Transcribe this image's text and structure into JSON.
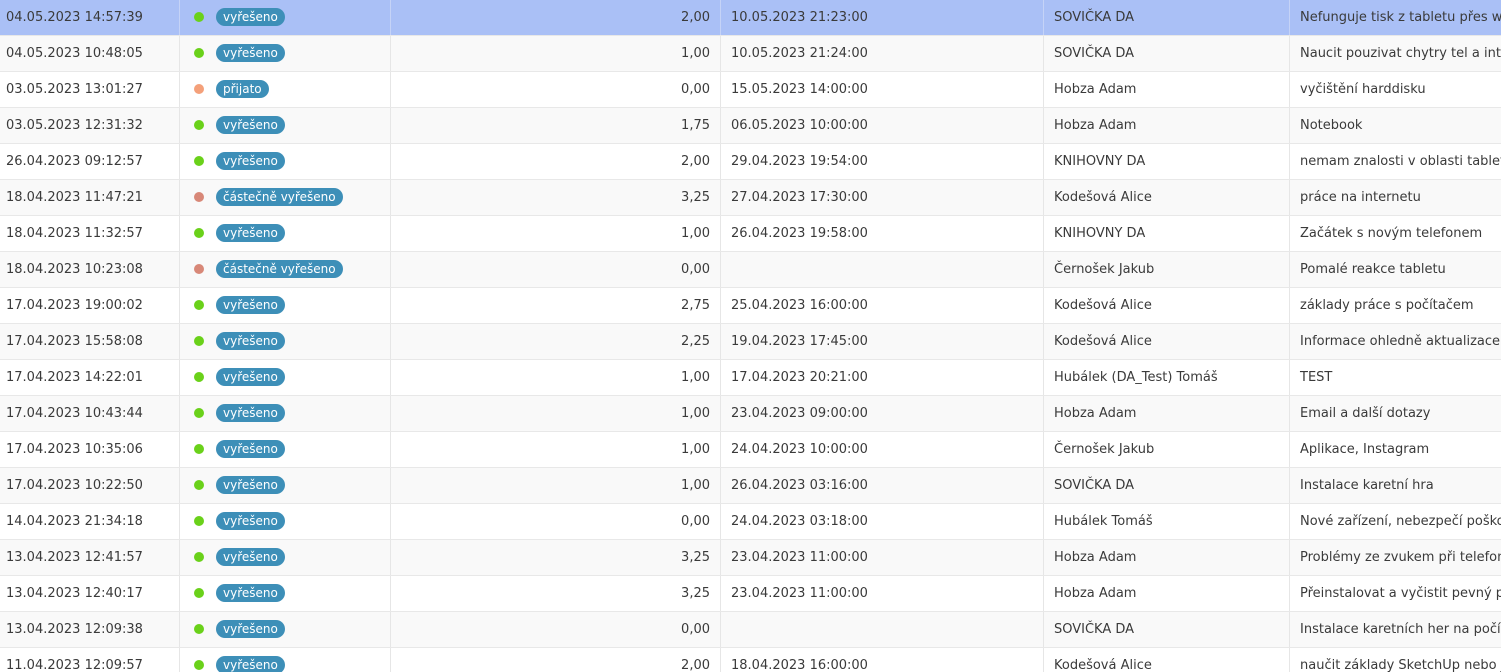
{
  "status_colors": {
    "vyřešeno": "#6ad11a",
    "přijato": "#f4a07a",
    "částečně vyřešeno": "#d88878"
  },
  "rows": [
    {
      "created": "04.05.2023 14:57:39",
      "status": "vyřešeno",
      "hours": "2,00",
      "due": "10.05.2023 21:23:00",
      "user": "SOVIČKA DA",
      "subject": "Nefunguje tisk z tabletu přes wifi",
      "selected": true
    },
    {
      "created": "04.05.2023 10:48:05",
      "status": "vyřešeno",
      "hours": "1,00",
      "due": "10.05.2023 21:24:00",
      "user": "SOVIČKA DA",
      "subject": "Naucit pouzivat chytry tel a interi"
    },
    {
      "created": "03.05.2023 13:01:27",
      "status": "přijato",
      "hours": "0,00",
      "due": "15.05.2023 14:00:00",
      "user": "Hobza Adam",
      "subject": "vyčištění harddisku"
    },
    {
      "created": "03.05.2023 12:31:32",
      "status": "vyřešeno",
      "hours": "1,75",
      "due": "06.05.2023 10:00:00",
      "user": "Hobza Adam",
      "subject": "Notebook"
    },
    {
      "created": "26.04.2023 09:12:57",
      "status": "vyřešeno",
      "hours": "2,00",
      "due": "29.04.2023 19:54:00",
      "user": "KNIHOVNY DA",
      "subject": "nemam znalosti v oblasti tabletu"
    },
    {
      "created": "18.04.2023 11:47:21",
      "status": "částečně vyřešeno",
      "hours": "3,25",
      "due": "27.04.2023 17:30:00",
      "user": "Kodešová Alice",
      "subject": "práce na internetu"
    },
    {
      "created": "18.04.2023 11:32:57",
      "status": "vyřešeno",
      "hours": "1,00",
      "due": "26.04.2023 19:58:00",
      "user": "KNIHOVNY DA",
      "subject": "Začátek s novým telefonem"
    },
    {
      "created": "18.04.2023 10:23:08",
      "status": "částečně vyřešeno",
      "hours": "0,00",
      "due": "",
      "user": "Černošek Jakub",
      "subject": "Pomalé reakce tabletu"
    },
    {
      "created": "17.04.2023 19:00:02",
      "status": "vyřešeno",
      "hours": "2,75",
      "due": "25.04.2023 16:00:00",
      "user": "Kodešová Alice",
      "subject": "základy práce s počítačem"
    },
    {
      "created": "17.04.2023 15:58:08",
      "status": "vyřešeno",
      "hours": "2,25",
      "due": "19.04.2023 17:45:00",
      "user": "Kodešová Alice",
      "subject": "Informace ohledně aktualizace."
    },
    {
      "created": "17.04.2023 14:22:01",
      "status": "vyřešeno",
      "hours": "1,00",
      "due": "17.04.2023 20:21:00",
      "user": "Hubálek (DA_Test) Tomáš",
      "subject": "TEST"
    },
    {
      "created": "17.04.2023 10:43:44",
      "status": "vyřešeno",
      "hours": "1,00",
      "due": "23.04.2023 09:00:00",
      "user": "Hobza Adam",
      "subject": "Email a další dotazy"
    },
    {
      "created": "17.04.2023 10:35:06",
      "status": "vyřešeno",
      "hours": "1,00",
      "due": "24.04.2023 10:00:00",
      "user": "Černošek Jakub",
      "subject": "Aplikace, Instagram"
    },
    {
      "created": "17.04.2023 10:22:50",
      "status": "vyřešeno",
      "hours": "1,00",
      "due": "26.04.2023 03:16:00",
      "user": "SOVIČKA DA",
      "subject": "Instalace karetní hra"
    },
    {
      "created": "14.04.2023 21:34:18",
      "status": "vyřešeno",
      "hours": "0,00",
      "due": "24.04.2023 03:18:00",
      "user": "Hubálek Tomáš",
      "subject": "Nové zařízení, nebezpečí poškoz"
    },
    {
      "created": "13.04.2023 12:41:57",
      "status": "vyřešeno",
      "hours": "3,25",
      "due": "23.04.2023 11:00:00",
      "user": "Hobza Adam",
      "subject": "Problémy ze zvukem při telefonát"
    },
    {
      "created": "13.04.2023 12:40:17",
      "status": "vyřešeno",
      "hours": "3,25",
      "due": "23.04.2023 11:00:00",
      "user": "Hobza Adam",
      "subject": "Přeinstalovat a vyčistit pevný pod"
    },
    {
      "created": "13.04.2023 12:09:38",
      "status": "vyřešeno",
      "hours": "0,00",
      "due": "",
      "user": "SOVIČKA DA",
      "subject": "Instalace karetních her na počítač"
    },
    {
      "created": "11.04.2023 12:09:57",
      "status": "vyřešeno",
      "hours": "2,00",
      "due": "18.04.2023 16:00:00",
      "user": "Kodešová Alice",
      "subject": "naučit základy SketchUp nebo jin"
    }
  ]
}
